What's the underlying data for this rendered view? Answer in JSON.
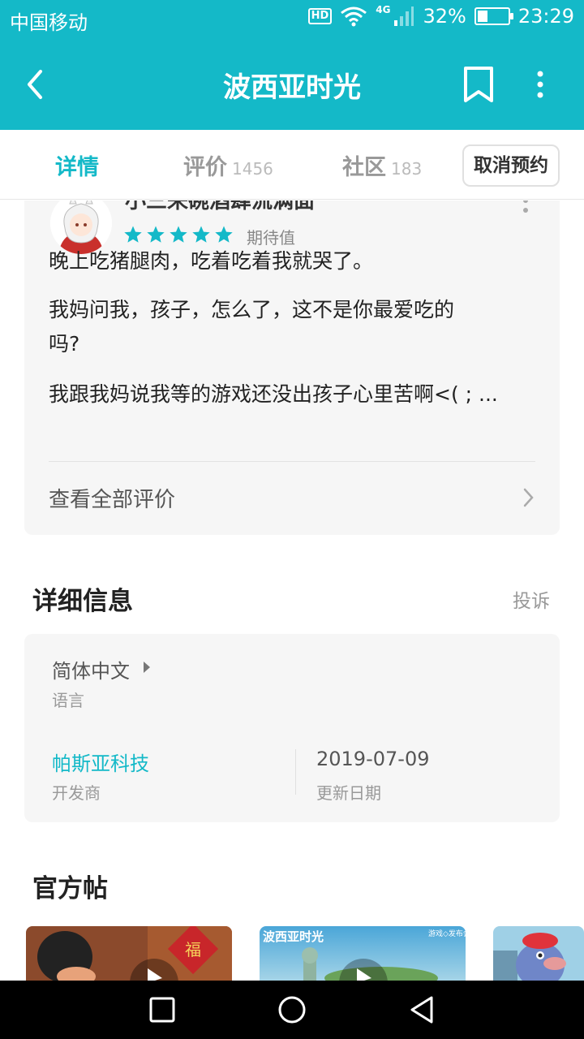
{
  "status_bar": {
    "carrier": "中国移动",
    "hd": "HD",
    "network": "4G",
    "battery_pct": "32%",
    "battery_level": 0.32,
    "time": "23:29"
  },
  "header": {
    "title": "波西亚时光",
    "icons": {
      "back": "back-arrow-icon",
      "bookmark": "bookmark-icon",
      "more": "more-vertical-icon"
    }
  },
  "tabs": [
    {
      "label": "详情",
      "count": "",
      "active": true
    },
    {
      "label": "评价",
      "count": "1456",
      "active": false
    },
    {
      "label": "社区",
      "count": "183",
      "active": false
    }
  ],
  "cancel_reservation_label": "取消预约",
  "review": {
    "reviewer_name": "小三来碗酒肆流满面",
    "stars": 5,
    "rating_label": "期待值",
    "lines": [
      "晚上吃猪腿肉，吃着吃着我就哭了。",
      "我妈问我，孩子，怎么了，这不是你最爱吃的",
      "吗?",
      "我跟我妈说我等的游戏还没出孩子心里苦啊<( ; ..."
    ],
    "see_all_label": "查看全部评价"
  },
  "details": {
    "title": "详细信息",
    "report_label": "投诉",
    "language_value": "简体中文",
    "language_label": "语言",
    "developer_value": "帕斯亚科技",
    "developer_label": "开发商",
    "update_value": "2019-07-09",
    "update_label": "更新日期"
  },
  "official_posts": {
    "title": "官方帖",
    "thumb2_caption": "波西亚时光",
    "thumb2_sub": "游戏◇发布会"
  },
  "colors": {
    "accent": "#14b9c8",
    "star": "#14b9c8",
    "card_bg": "#f6f6f6"
  }
}
